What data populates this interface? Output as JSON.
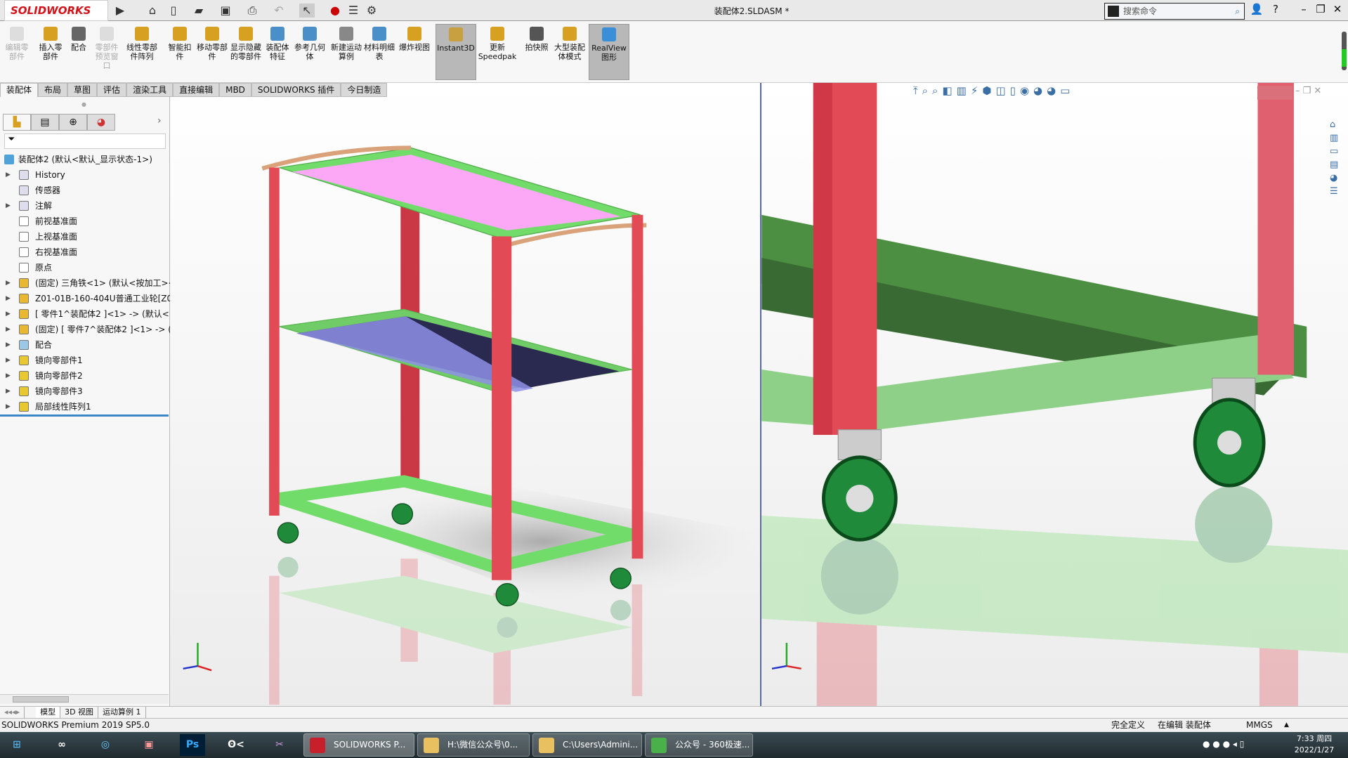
{
  "app": {
    "logo": "SOLIDWORKS",
    "title": "装配体2.SLDASM *",
    "search_placeholder": "搜索命令"
  },
  "colors": {
    "frame_red": "#e24a55",
    "frame_green": "#72dc6a",
    "shelf_pink": "#fda7f7",
    "shelf_blue": "#8f8fe8",
    "wheel_green": "#1e8a3a",
    "brand_red": "#d4121a"
  },
  "quick_access": [
    "home-icon",
    "new-icon",
    "open-icon",
    "save-icon",
    "print-icon",
    "undo-icon",
    "select-icon",
    "traffic-light-icon",
    "list-icon",
    "gear-icon"
  ],
  "ribbon": [
    {
      "label": "编辑零部件",
      "disabled": true
    },
    {
      "label": "插入零部件"
    },
    {
      "label": "配合"
    },
    {
      "label": "零部件预览窗口",
      "disabled": true
    },
    {
      "label": "线性零部件阵列"
    },
    {
      "label": "智能扣件"
    },
    {
      "label": "移动零部件"
    },
    {
      "label": "显示隐藏的零部件"
    },
    {
      "label": "装配体特征"
    },
    {
      "label": "参考几何体"
    },
    {
      "label": "新建运动算例"
    },
    {
      "label": "材料明细表"
    },
    {
      "label": "爆炸视图"
    },
    {
      "label": "Instant3D",
      "active": true
    },
    {
      "label": "更新Speedpak"
    },
    {
      "label": "拍快照"
    },
    {
      "label": "大型装配体模式"
    },
    {
      "label": "RealView图形",
      "active": true
    }
  ],
  "tabs": [
    "装配体",
    "布局",
    "草图",
    "评估",
    "渲染工具",
    "直接编辑",
    "MBD",
    "SOLIDWORKS 插件",
    "今日制造"
  ],
  "tree": {
    "root": "装配体2  (默认<默认_显示状态-1>)",
    "items": [
      {
        "label": "History",
        "icon": "history-folder-icon",
        "expandable": true
      },
      {
        "label": "传感器",
        "icon": "sensor-folder-icon",
        "expandable": false
      },
      {
        "label": "注解",
        "icon": "annotation-icon",
        "expandable": true
      },
      {
        "label": "前视基准面",
        "icon": "plane-icon",
        "expandable": false
      },
      {
        "label": "上视基准面",
        "icon": "plane-icon",
        "expandable": false
      },
      {
        "label": "右视基准面",
        "icon": "plane-icon",
        "expandable": false
      },
      {
        "label": "原点",
        "icon": "origin-icon",
        "expandable": false
      },
      {
        "label": "(固定) 三角铁<1> (默认<按加工><",
        "icon": "part-icon",
        "expandable": true
      },
      {
        "label": "Z01-01B-160-404U普通工业轮[Z01",
        "icon": "part-icon",
        "expandable": true
      },
      {
        "label": "[ 零件1^装配体2 ]<1> -> (默认<<",
        "icon": "part-icon",
        "expandable": true
      },
      {
        "label": "(固定) [ 零件7^装配体2 ]<1> -> (默",
        "icon": "part-icon",
        "expandable": true
      },
      {
        "label": "配合",
        "icon": "mate-icon",
        "expandable": true
      },
      {
        "label": "镜向零部件1",
        "icon": "mirror-icon",
        "expandable": true
      },
      {
        "label": "镜向零部件2",
        "icon": "mirror-icon",
        "expandable": true
      },
      {
        "label": "镜向零部件3",
        "icon": "mirror-icon",
        "expandable": true
      },
      {
        "label": "局部线性阵列1",
        "icon": "pattern-icon",
        "expandable": true
      }
    ]
  },
  "bottom_tabs": [
    "模型",
    "3D 视图",
    "运动算例 1"
  ],
  "status": {
    "version": "SOLIDWORKS Premium 2019 SP5.0",
    "state": "完全定义",
    "editing": "在编辑 装配体",
    "units": "MMGS"
  },
  "taskbar": {
    "windows": [
      {
        "label": "SOLIDWORKS P...",
        "active": true
      },
      {
        "label": "H:\\微信公众号\\0..."
      },
      {
        "label": "C:\\Users\\Admini..."
      },
      {
        "label": "公众号 - 360极速..."
      }
    ],
    "time": "7:33 周四",
    "date": "2022/1/27"
  }
}
